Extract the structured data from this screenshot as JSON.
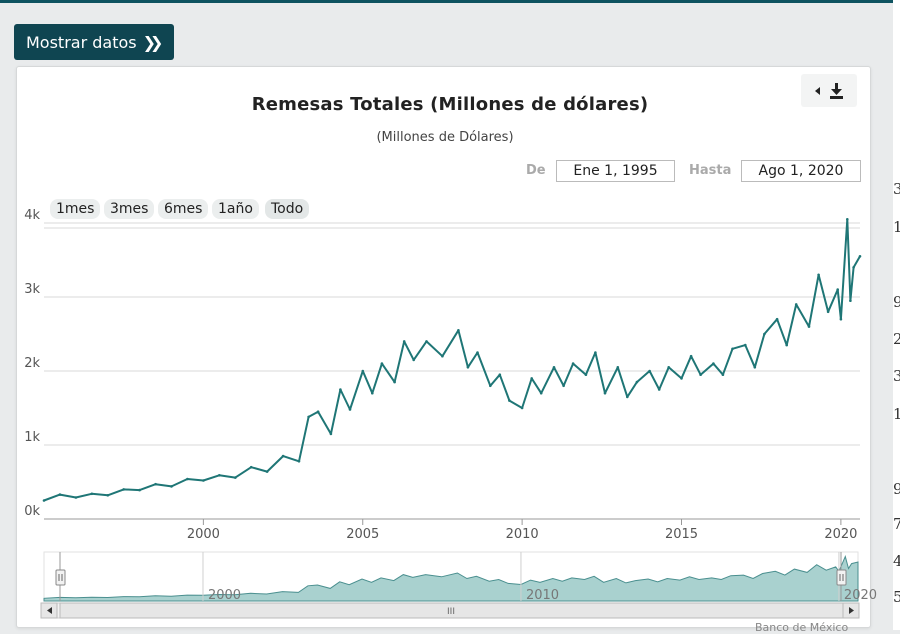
{
  "show_data_button": {
    "label": "Mostrar datos",
    "icon": "double-chevron-right-icon"
  },
  "export_menu": {
    "icons": [
      "caret-left-icon",
      "download-icon"
    ]
  },
  "range_selector": {
    "buttons": [
      "1mes",
      "3mes",
      "6mes",
      "1año",
      "Todo"
    ],
    "active": "Todo",
    "from_label": "De",
    "from_value": "Ene 1, 1995",
    "to_label": "Hasta",
    "to_value": "Ago 1, 2020"
  },
  "navigator": {
    "ticks": [
      "2000",
      "2010",
      "2020"
    ],
    "scrollbar_grip": "III"
  },
  "credit": "Banco de México",
  "background_page_digits": [
    "3",
    "1",
    "9",
    "2",
    "3",
    "1",
    "9",
    "7",
    "4",
    "5"
  ],
  "colors": {
    "line": "#1f7676",
    "navigator_fill": "#a9d1cf",
    "button_dark": "#0f4551",
    "gridline": "#d8d8d8"
  },
  "chart_data": {
    "type": "line",
    "title": "Remesas Totales (Millones de dólares)",
    "subtitle": "(Millones de Dólares)",
    "xlabel": "",
    "ylabel": "",
    "xlim": [
      1995.0,
      2020.6
    ],
    "ylim": [
      0,
      4000
    ],
    "yticks": [
      {
        "value": 0,
        "label": "0k"
      },
      {
        "value": 1000,
        "label": "1k"
      },
      {
        "value": 2000,
        "label": "2k"
      },
      {
        "value": 3000,
        "label": "3k"
      },
      {
        "value": 4000,
        "label": "4k"
      }
    ],
    "xticks": [
      {
        "value": 2000,
        "label": "2000"
      },
      {
        "value": 2005,
        "label": "2005"
      },
      {
        "value": 2010,
        "label": "2010"
      },
      {
        "value": 2015,
        "label": "2015"
      },
      {
        "value": 2020,
        "label": "2020"
      }
    ],
    "grid": true,
    "legend": "none",
    "series": [
      {
        "x": [
          1995.0,
          1995.5,
          1996.0,
          1996.5,
          1997.0,
          1997.5,
          1998.0,
          1998.5,
          1999.0,
          1999.5,
          2000.0,
          2000.5,
          2001.0,
          2001.5,
          2002.0,
          2002.5,
          2003.0,
          2003.3,
          2003.6,
          2004.0,
          2004.3,
          2004.6,
          2005.0,
          2005.3,
          2005.6,
          2006.0,
          2006.3,
          2006.6,
          2007.0,
          2007.5,
          2008.0,
          2008.3,
          2008.6,
          2009.0,
          2009.3,
          2009.6,
          2010.0,
          2010.3,
          2010.6,
          2011.0,
          2011.3,
          2011.6,
          2012.0,
          2012.3,
          2012.6,
          2013.0,
          2013.3,
          2013.6,
          2014.0,
          2014.3,
          2014.6,
          2015.0,
          2015.3,
          2015.6,
          2016.0,
          2016.3,
          2016.6,
          2017.0,
          2017.3,
          2017.6,
          2018.0,
          2018.3,
          2018.6,
          2019.0,
          2019.3,
          2019.6,
          2019.9,
          2020.0,
          2020.2,
          2020.3,
          2020.4,
          2020.6
        ],
        "values": [
          250,
          330,
          290,
          340,
          320,
          400,
          390,
          470,
          440,
          540,
          520,
          590,
          560,
          700,
          640,
          850,
          780,
          1380,
          1450,
          1150,
          1750,
          1480,
          2000,
          1700,
          2100,
          1850,
          2400,
          2150,
          2400,
          2200,
          2550,
          2050,
          2250,
          1800,
          1950,
          1600,
          1500,
          1900,
          1700,
          2050,
          1800,
          2100,
          1950,
          2250,
          1700,
          2050,
          1650,
          1850,
          2000,
          1750,
          2050,
          1900,
          2200,
          1950,
          2100,
          1950,
          2300,
          2350,
          2050,
          2500,
          2700,
          2350,
          2900,
          2600,
          3300,
          2800,
          3100,
          2700,
          4050,
          2950,
          3400,
          3550
        ]
      }
    ]
  }
}
